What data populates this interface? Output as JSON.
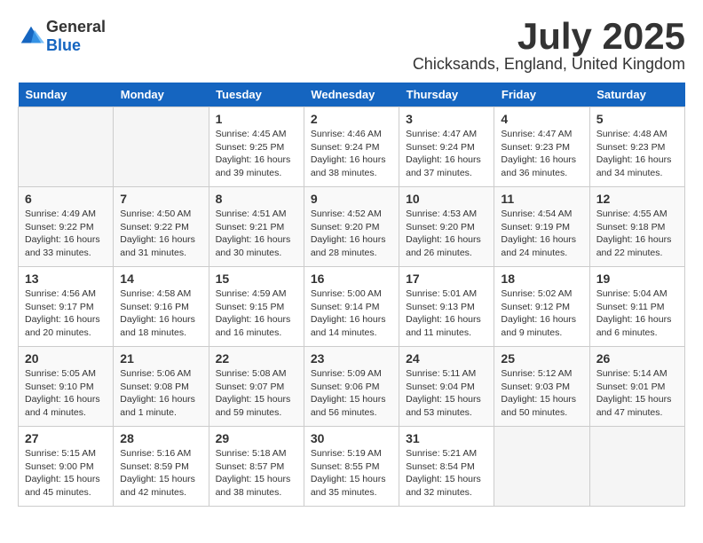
{
  "header": {
    "logo": {
      "general": "General",
      "blue": "Blue"
    },
    "month": "July 2025",
    "location": "Chicksands, England, United Kingdom"
  },
  "days_of_week": [
    "Sunday",
    "Monday",
    "Tuesday",
    "Wednesday",
    "Thursday",
    "Friday",
    "Saturday"
  ],
  "weeks": [
    [
      {
        "day": "",
        "sunrise": "",
        "sunset": "",
        "daylight": ""
      },
      {
        "day": "",
        "sunrise": "",
        "sunset": "",
        "daylight": ""
      },
      {
        "day": "1",
        "sunrise": "Sunrise: 4:45 AM",
        "sunset": "Sunset: 9:25 PM",
        "daylight": "Daylight: 16 hours and 39 minutes."
      },
      {
        "day": "2",
        "sunrise": "Sunrise: 4:46 AM",
        "sunset": "Sunset: 9:24 PM",
        "daylight": "Daylight: 16 hours and 38 minutes."
      },
      {
        "day": "3",
        "sunrise": "Sunrise: 4:47 AM",
        "sunset": "Sunset: 9:24 PM",
        "daylight": "Daylight: 16 hours and 37 minutes."
      },
      {
        "day": "4",
        "sunrise": "Sunrise: 4:47 AM",
        "sunset": "Sunset: 9:23 PM",
        "daylight": "Daylight: 16 hours and 36 minutes."
      },
      {
        "day": "5",
        "sunrise": "Sunrise: 4:48 AM",
        "sunset": "Sunset: 9:23 PM",
        "daylight": "Daylight: 16 hours and 34 minutes."
      }
    ],
    [
      {
        "day": "6",
        "sunrise": "Sunrise: 4:49 AM",
        "sunset": "Sunset: 9:22 PM",
        "daylight": "Daylight: 16 hours and 33 minutes."
      },
      {
        "day": "7",
        "sunrise": "Sunrise: 4:50 AM",
        "sunset": "Sunset: 9:22 PM",
        "daylight": "Daylight: 16 hours and 31 minutes."
      },
      {
        "day": "8",
        "sunrise": "Sunrise: 4:51 AM",
        "sunset": "Sunset: 9:21 PM",
        "daylight": "Daylight: 16 hours and 30 minutes."
      },
      {
        "day": "9",
        "sunrise": "Sunrise: 4:52 AM",
        "sunset": "Sunset: 9:20 PM",
        "daylight": "Daylight: 16 hours and 28 minutes."
      },
      {
        "day": "10",
        "sunrise": "Sunrise: 4:53 AM",
        "sunset": "Sunset: 9:20 PM",
        "daylight": "Daylight: 16 hours and 26 minutes."
      },
      {
        "day": "11",
        "sunrise": "Sunrise: 4:54 AM",
        "sunset": "Sunset: 9:19 PM",
        "daylight": "Daylight: 16 hours and 24 minutes."
      },
      {
        "day": "12",
        "sunrise": "Sunrise: 4:55 AM",
        "sunset": "Sunset: 9:18 PM",
        "daylight": "Daylight: 16 hours and 22 minutes."
      }
    ],
    [
      {
        "day": "13",
        "sunrise": "Sunrise: 4:56 AM",
        "sunset": "Sunset: 9:17 PM",
        "daylight": "Daylight: 16 hours and 20 minutes."
      },
      {
        "day": "14",
        "sunrise": "Sunrise: 4:58 AM",
        "sunset": "Sunset: 9:16 PM",
        "daylight": "Daylight: 16 hours and 18 minutes."
      },
      {
        "day": "15",
        "sunrise": "Sunrise: 4:59 AM",
        "sunset": "Sunset: 9:15 PM",
        "daylight": "Daylight: 16 hours and 16 minutes."
      },
      {
        "day": "16",
        "sunrise": "Sunrise: 5:00 AM",
        "sunset": "Sunset: 9:14 PM",
        "daylight": "Daylight: 16 hours and 14 minutes."
      },
      {
        "day": "17",
        "sunrise": "Sunrise: 5:01 AM",
        "sunset": "Sunset: 9:13 PM",
        "daylight": "Daylight: 16 hours and 11 minutes."
      },
      {
        "day": "18",
        "sunrise": "Sunrise: 5:02 AM",
        "sunset": "Sunset: 9:12 PM",
        "daylight": "Daylight: 16 hours and 9 minutes."
      },
      {
        "day": "19",
        "sunrise": "Sunrise: 5:04 AM",
        "sunset": "Sunset: 9:11 PM",
        "daylight": "Daylight: 16 hours and 6 minutes."
      }
    ],
    [
      {
        "day": "20",
        "sunrise": "Sunrise: 5:05 AM",
        "sunset": "Sunset: 9:10 PM",
        "daylight": "Daylight: 16 hours and 4 minutes."
      },
      {
        "day": "21",
        "sunrise": "Sunrise: 5:06 AM",
        "sunset": "Sunset: 9:08 PM",
        "daylight": "Daylight: 16 hours and 1 minute."
      },
      {
        "day": "22",
        "sunrise": "Sunrise: 5:08 AM",
        "sunset": "Sunset: 9:07 PM",
        "daylight": "Daylight: 15 hours and 59 minutes."
      },
      {
        "day": "23",
        "sunrise": "Sunrise: 5:09 AM",
        "sunset": "Sunset: 9:06 PM",
        "daylight": "Daylight: 15 hours and 56 minutes."
      },
      {
        "day": "24",
        "sunrise": "Sunrise: 5:11 AM",
        "sunset": "Sunset: 9:04 PM",
        "daylight": "Daylight: 15 hours and 53 minutes."
      },
      {
        "day": "25",
        "sunrise": "Sunrise: 5:12 AM",
        "sunset": "Sunset: 9:03 PM",
        "daylight": "Daylight: 15 hours and 50 minutes."
      },
      {
        "day": "26",
        "sunrise": "Sunrise: 5:14 AM",
        "sunset": "Sunset: 9:01 PM",
        "daylight": "Daylight: 15 hours and 47 minutes."
      }
    ],
    [
      {
        "day": "27",
        "sunrise": "Sunrise: 5:15 AM",
        "sunset": "Sunset: 9:00 PM",
        "daylight": "Daylight: 15 hours and 45 minutes."
      },
      {
        "day": "28",
        "sunrise": "Sunrise: 5:16 AM",
        "sunset": "Sunset: 8:59 PM",
        "daylight": "Daylight: 15 hours and 42 minutes."
      },
      {
        "day": "29",
        "sunrise": "Sunrise: 5:18 AM",
        "sunset": "Sunset: 8:57 PM",
        "daylight": "Daylight: 15 hours and 38 minutes."
      },
      {
        "day": "30",
        "sunrise": "Sunrise: 5:19 AM",
        "sunset": "Sunset: 8:55 PM",
        "daylight": "Daylight: 15 hours and 35 minutes."
      },
      {
        "day": "31",
        "sunrise": "Sunrise: 5:21 AM",
        "sunset": "Sunset: 8:54 PM",
        "daylight": "Daylight: 15 hours and 32 minutes."
      },
      {
        "day": "",
        "sunrise": "",
        "sunset": "",
        "daylight": ""
      },
      {
        "day": "",
        "sunrise": "",
        "sunset": "",
        "daylight": ""
      }
    ]
  ]
}
